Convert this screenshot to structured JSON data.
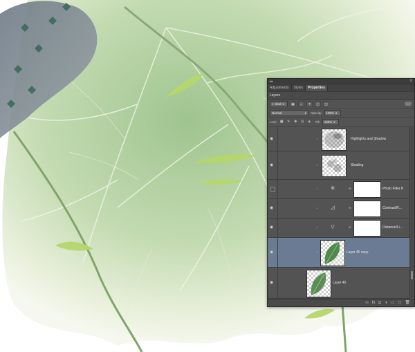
{
  "panel": {
    "tabs": [
      "Adjustments",
      "Styles",
      "Properties"
    ],
    "active_tab": "Properties",
    "title": "Layers",
    "filter": {
      "kind_label": "Kind",
      "icons": [
        "pixel-filter-icon",
        "adjustment-filter-icon",
        "type-filter-icon",
        "shape-filter-icon",
        "smart-object-filter-icon"
      ]
    },
    "blend": {
      "mode": "Normal",
      "opacity_label": "Opacity:",
      "opacity": "100%",
      "fill_label": "Fill:",
      "fill": "100%"
    },
    "lock": {
      "label": "Lock:",
      "icons": [
        "lock-transparency-icon",
        "lock-pixels-icon",
        "lock-position-icon",
        "lock-artboard-icon",
        "lock-all-icon"
      ]
    },
    "layers": [
      {
        "name": "Highlights and Shadow",
        "kind": "smart"
      },
      {
        "name": "Shading",
        "kind": "smart"
      },
      {
        "name": "Photo Filter 8",
        "kind": "adjustment",
        "icon": "photo-filter-icon"
      },
      {
        "name": "Contrast/R...",
        "kind": "adjustment",
        "icon": "curves-icon"
      },
      {
        "name": "Distance/Li...",
        "kind": "adjustment",
        "icon": "levels-icon"
      },
      {
        "name": "Layer 45 copy",
        "kind": "pixel",
        "selected": true
      },
      {
        "name": "Layer 45",
        "kind": "pixel"
      }
    ],
    "footer_icons": [
      "link-layers-icon",
      "fx-icon",
      "mask-icon",
      "new-adjustment-icon",
      "folder-icon",
      "new-layer-icon",
      "trash-icon"
    ],
    "footer_labels": [
      "∞",
      "fx",
      "◘",
      "◑",
      "▭",
      "◻",
      "🗑"
    ]
  }
}
